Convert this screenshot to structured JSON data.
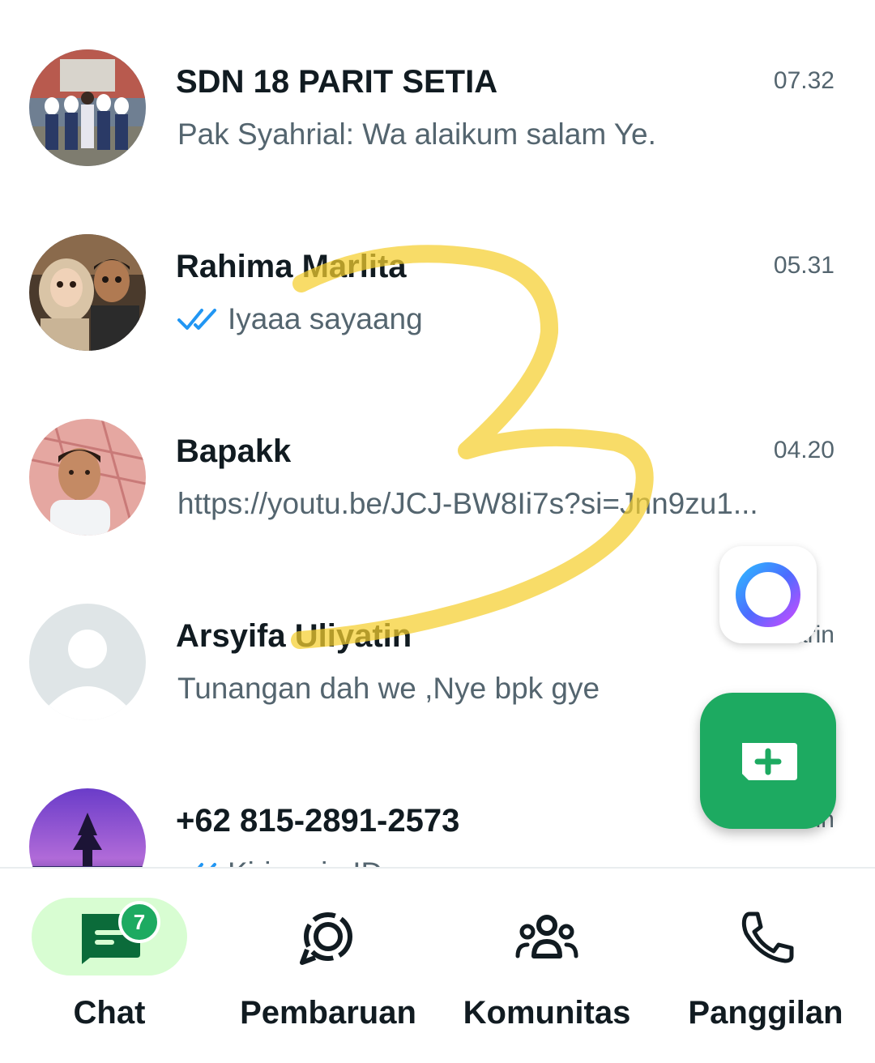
{
  "colors": {
    "accent": "#1daa61",
    "nav_active_bg": "#d8fdd2",
    "read_tick": "#2196f3",
    "annotation": "#f5cf2e"
  },
  "chats": [
    {
      "name": "SDN 18 PARIT SETIA",
      "time": "07.32",
      "preview": "Pak Syahrial:  Wa alaikum salam  Ye.",
      "avatar": "group-photo"
    },
    {
      "name": "Rahima Marlita",
      "time": "05.31",
      "preview": "Iyaaa sayaang",
      "read_ticks": true,
      "avatar": "couple-photo"
    },
    {
      "name": "Bapakk",
      "time": "04.20",
      "preview": "https://youtu.be/JCJ-BW8Ii7s?si=Jnn9zu1...",
      "avatar": "man-photo"
    },
    {
      "name": "Arsyifa Uliyatin",
      "time": "Kemarin",
      "preview": "Tunangan dah we ,Nye bpk gye",
      "avatar": "default-person-icon"
    },
    {
      "name": "+62 815-2891-2573",
      "time": "Kemarin",
      "preview": "Kirim aja ID nya",
      "read_ticks": true,
      "avatar": "temple-photo"
    }
  ],
  "meta_ai_button": {
    "icon": "meta-ai-ring-icon"
  },
  "new_chat_button": {
    "icon": "new-chat-plus-icon"
  },
  "nav": {
    "items": [
      {
        "label": "Chat",
        "icon": "chat-icon",
        "active": true,
        "badge": "7"
      },
      {
        "label": "Pembaruan",
        "icon": "updates-icon",
        "active": false
      },
      {
        "label": "Komunitas",
        "icon": "communities-icon",
        "active": false
      },
      {
        "label": "Panggilan",
        "icon": "phone-icon",
        "active": false
      }
    ]
  }
}
